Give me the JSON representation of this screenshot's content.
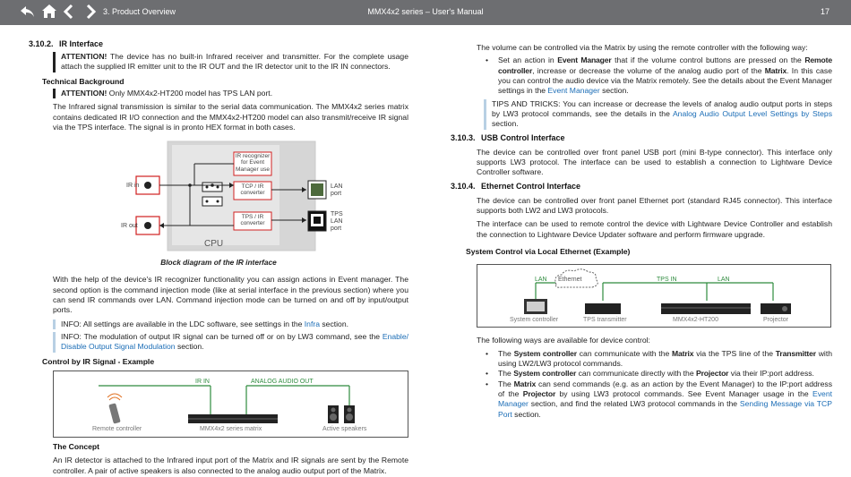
{
  "header": {
    "section": "3. Product Overview",
    "doc_title": "MMX4x2 series – User's Manual",
    "page_number": "17"
  },
  "left": {
    "h_ir": {
      "num": "3.10.2.",
      "title": "IR Interface"
    },
    "attn1_label": "ATTENTION!",
    "attn1_text": " The device has no built-in Infrared receiver and transmitter. For the complete usage attach the supplied IR emitter unit to the IR OUT and the IR detector unit to the IR IN connectors.",
    "h_tech": "Technical Background",
    "attn2_label": "ATTENTION!",
    "attn2_text": " Only MMX4x2-HT200 model has TPS LAN port.",
    "tech_p": "The Infrared signal transmission is similar to the serial data communication. The MMX4x2 series matrix contains dedicated IR I/O connection and the MMX4x2-HT200 model can also transmit/receive IR signal via the TPS interface. The signal is in pronto HEX format in both cases.",
    "block": {
      "ir_in": "IR in",
      "ir_out": "IR out",
      "recognizer": [
        "IR recognizer",
        "for Event",
        "Manager use"
      ],
      "tcp_conv": [
        "TCP / IR",
        "converter"
      ],
      "tps_conv": [
        "TPS / IR",
        "converter"
      ],
      "cpu": "CPU",
      "lan_port": [
        "LAN",
        "port"
      ],
      "tps_port": [
        "TPS",
        "LAN",
        "port"
      ]
    },
    "caption": "Block diagram of the IR interface",
    "event_p": "With the help of the device's IR recognizer functionality you can assign actions in Event manager. The second option is the command injection mode (like at serial interface in the previous section) where you can send IR commands over LAN. Command injection mode can be turned on and off by input/output ports.",
    "info1_pre": "INFO: All settings are available in the LDC software, see settings in the ",
    "info1_link": "Infra",
    "info1_post": " section.",
    "info2_pre": "INFO: The modulation of output IR signal can be turned off or on by LW3 command, see the ",
    "info2_link": "Enable/ Disable Output Signal Modulation",
    "info2_post": " section.",
    "h_control": "Control by IR Signal - Example",
    "example": {
      "ir_in": "IR IN",
      "analog_out": "ANALOG AUDIO OUT",
      "remote": "Remote controller",
      "matrix": "MMX4x2 series matrix",
      "speakers": "Active speakers"
    },
    "h_concept": "The Concept",
    "concept_p": "An IR detector is attached to the Infrared input port of the Matrix and IR signals are sent by the Remote controller. A pair of active speakers is also connected to the analog audio output port of the Matrix."
  },
  "right": {
    "volume_p": "The volume can be controlled via the Matrix by using the remote controller with the following way:",
    "bullet1": {
      "t1": "Set an action in ",
      "b1": "Event Manager",
      "t2": " that if the volume control buttons are pressed on the ",
      "b2": "Remote controller",
      "t3": ", increase or decrease the volume of the analog audio port of the ",
      "b3": "Matrix",
      "t4": ". In this case you can control the audio device via the Matrix remotely. See the details about the Event Manager settings in the ",
      "link": "Event Manager",
      "t5": " section."
    },
    "tip_pre": "TIPS AND TRICKS: You can increase or decrease the levels of analog audio output ports in steps by LW3 protocol commands, see the details in the ",
    "tip_link": "Analog Audio Output Level Settings by Steps",
    "tip_post": " section.",
    "h_usb": {
      "num": "3.10.3.",
      "title": "USB Control Interface"
    },
    "usb_p": "The device can be controlled over front panel USB port (mini B-type connector). This interface only supports LW3 protocol. The interface can be used to establish a connection to Lightware Device Controller software.",
    "h_eth": {
      "num": "3.10.4.",
      "title": "Ethernet Control Interface"
    },
    "eth_p1": "The device can be controlled over front panel Ethernet port (standard RJ45 connector). This interface supports both LW2 and LW3 protocols.",
    "eth_p2": "The interface can be used to remote control the device with Lightware Device Controller and establish the connection to Lightware Device Updater software and perform firmware upgrade.",
    "h_sys": "System Control via Local Ethernet (Example)",
    "sys": {
      "lan1": "LAN",
      "ethernet": "Ethernet",
      "tps_in": "TPS IN",
      "lan2": "LAN",
      "system_controller": "System controller",
      "tps_transmitter": "TPS transmitter",
      "matrix": "MMX4x2-HT200",
      "projector": "Projector"
    },
    "ways_p": "The following ways are available for device control:",
    "w1": {
      "t1": "The ",
      "b1": "System controller",
      "t2": " can communicate with the ",
      "b2": "Matrix",
      "t3": " via the TPS line of the ",
      "b3": "Transmitter",
      "t4": " with using LW2/LW3 protocol commands."
    },
    "w2": {
      "t1": "The ",
      "b1": "System controller",
      "t2": " can communicate directly with the ",
      "b2": "Projector",
      "t3": " via their IP:port address."
    },
    "w3": {
      "t1": "The ",
      "b1": "Matrix",
      "t2": " can send commands (e.g. as an action by the Event Manager) to the IP:port address of the ",
      "b2": "Projector",
      "t3": " by using LW3 protocol commands. See Event Manager usage in the ",
      "link1": "Event Manager",
      "t4": " section, and find the related LW3 protocol commands in the ",
      "link2": "Sending Message via TCP Port",
      "t5": " section."
    }
  }
}
